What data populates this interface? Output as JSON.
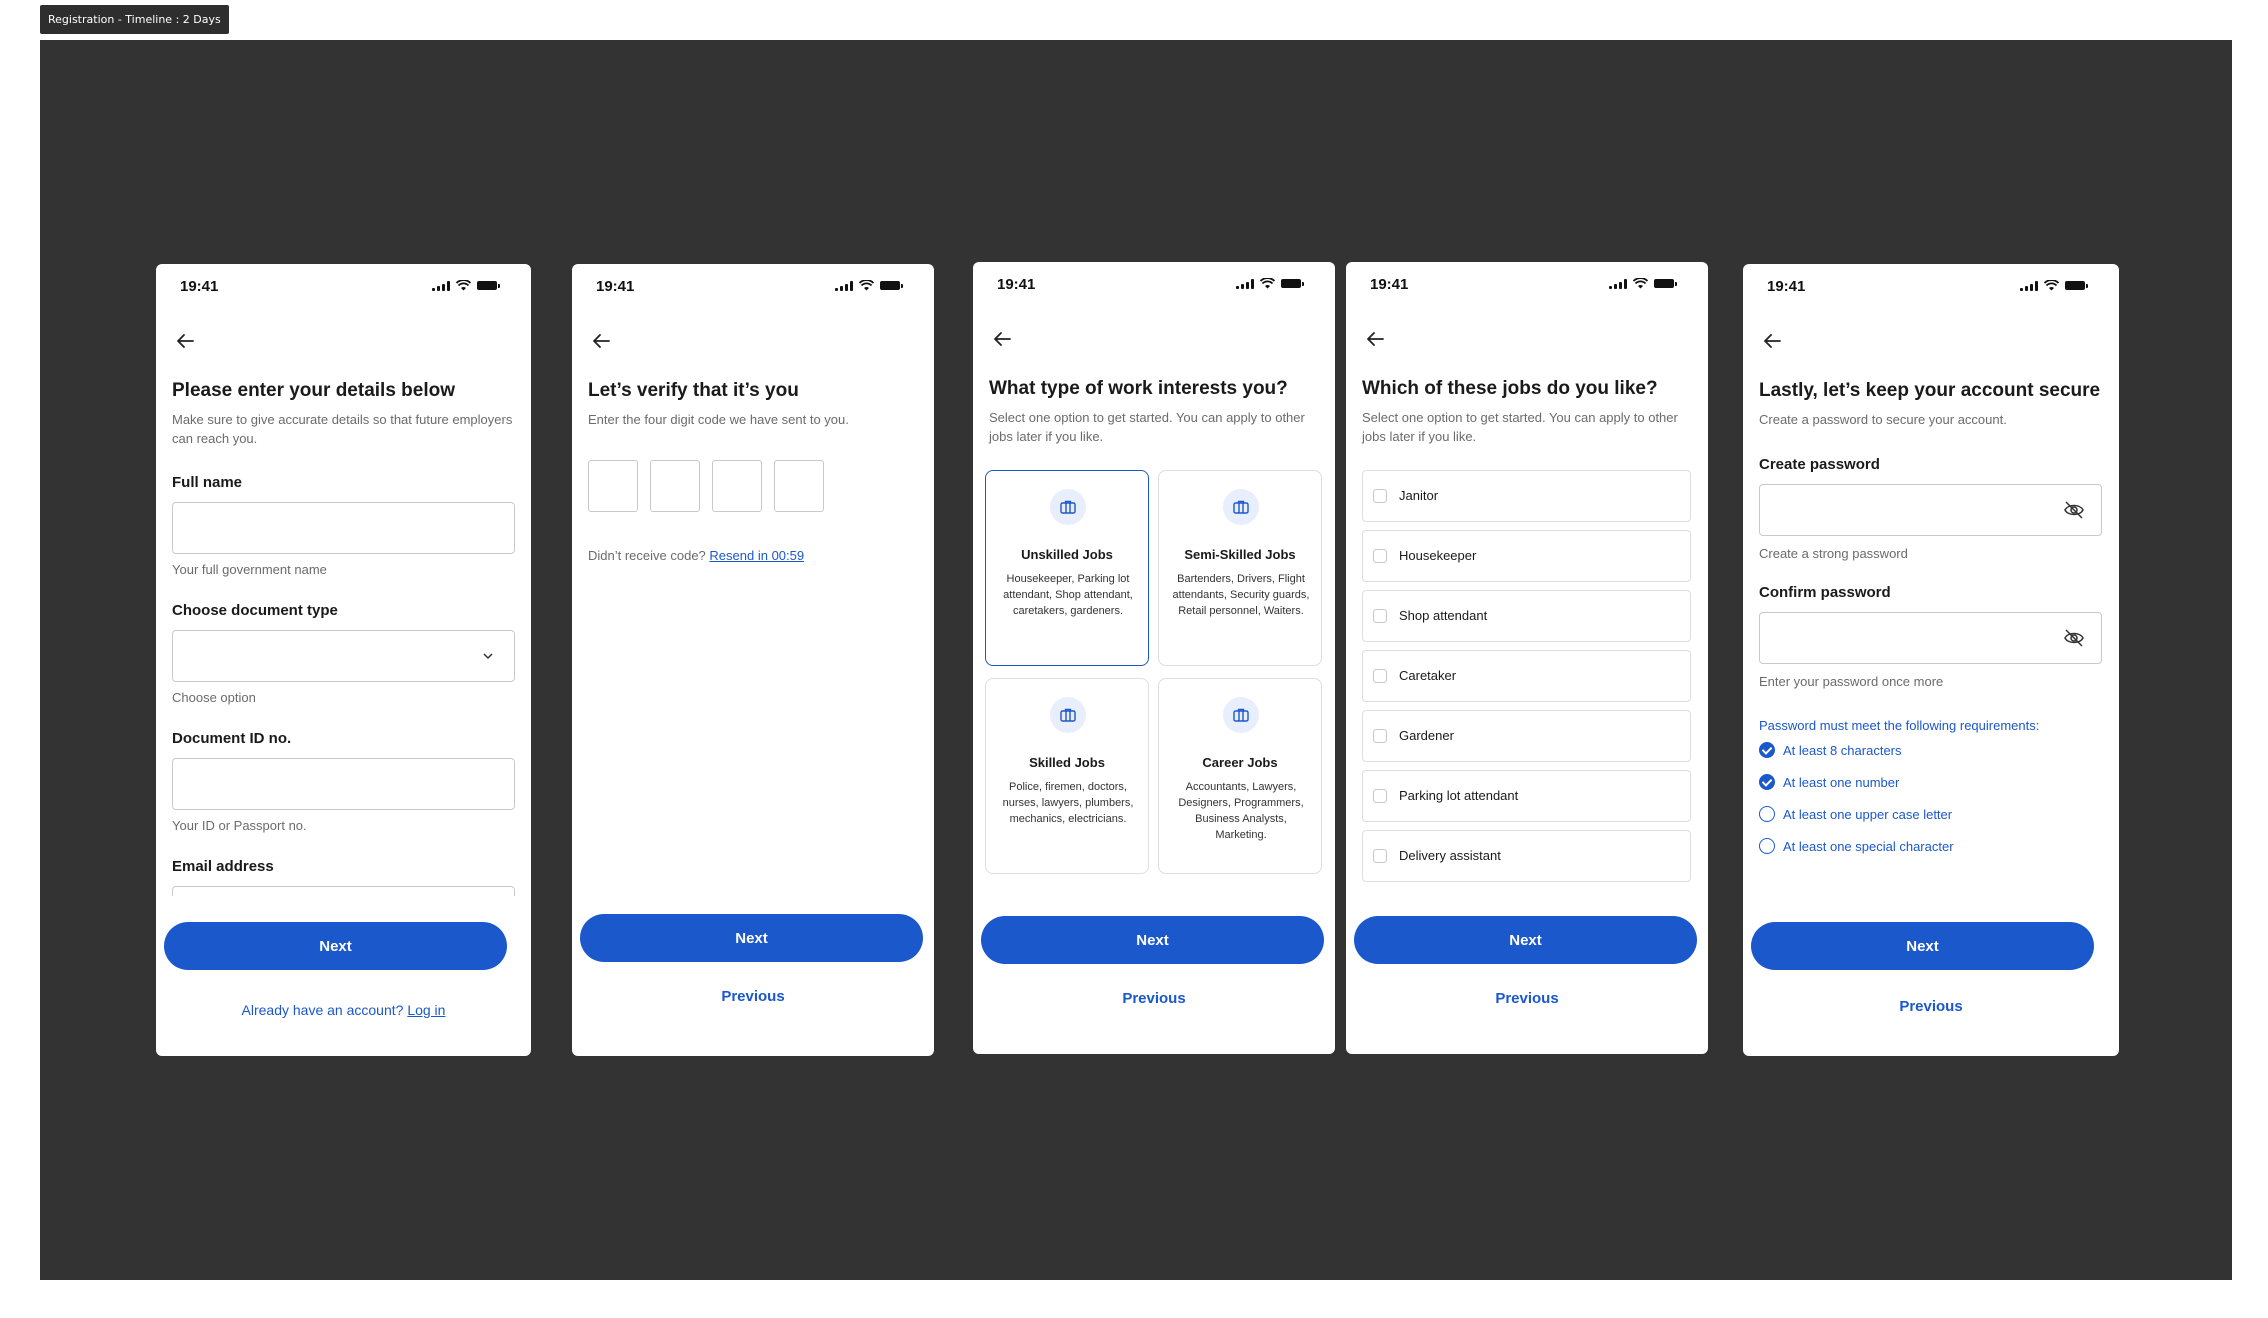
{
  "frame_label": "Registration - Timeline : 2 Days",
  "status_time": "19:41",
  "screens": {
    "details": {
      "title": "Please enter your details below",
      "subtitle": "Make sure to give accurate details so that future employers can reach you.",
      "full_name_label": "Full name",
      "full_name_hint": "Your full government name",
      "doc_type_label": "Choose document type",
      "doc_type_hint": "Choose option",
      "doc_id_label": "Document ID no.",
      "doc_id_hint": "Your ID or Passport no.",
      "email_label": "Email address",
      "next": "Next",
      "login_prompt": "Already have an account?",
      "login_link": "Log in"
    },
    "verify": {
      "title": "Let’s verify that it’s you",
      "subtitle": "Enter the four digit code we have sent to you.",
      "resend_prompt": "Didn’t receive code?",
      "resend_link": "Resend in 00:59",
      "next": "Next",
      "previous": "Previous"
    },
    "work_type": {
      "title": "What type of work interests you?",
      "subtitle": "Select one option to get started. You can apply to other jobs later if you like.",
      "cards": [
        {
          "title": "Unskilled Jobs",
          "desc": "Housekeeper, Parking lot attendant, Shop attendant, caretakers, gardeners.",
          "selected": true
        },
        {
          "title": "Semi-Skilled Jobs",
          "desc": "Bartenders, Drivers, Flight attendants, Security guards, Retail personnel, Waiters.",
          "selected": false
        },
        {
          "title": "Skilled Jobs",
          "desc": "Police, firemen, doctors, nurses, lawyers, plumbers, mechanics, electricians.",
          "selected": false
        },
        {
          "title": "Career Jobs",
          "desc": "Accountants, Lawyers, Designers, Programmers, Business Analysts, Marketing.",
          "selected": false
        }
      ],
      "next": "Next",
      "previous": "Previous"
    },
    "jobs": {
      "title": "Which of these jobs do you like?",
      "subtitle": "Select one option to get started. You can apply to other jobs later if you like.",
      "items": [
        "Janitor",
        "Housekeeper",
        "Shop attendant",
        "Caretaker",
        "Gardener",
        "Parking lot attendant",
        "Delivery assistant"
      ],
      "next": "Next",
      "previous": "Previous"
    },
    "password": {
      "title": "Lastly, let’s keep your account secure",
      "subtitle": "Create a password to secure your account.",
      "create_label": "Create password",
      "create_hint": "Create a strong password",
      "confirm_label": "Confirm password",
      "confirm_hint": "Enter your password once more",
      "req_title": "Password must meet the following requirements:",
      "requirements": [
        {
          "text": "At least 8 characters",
          "met": true
        },
        {
          "text": "At least one number",
          "met": true
        },
        {
          "text": "At least one upper case letter",
          "met": false
        },
        {
          "text": "At least one special character",
          "met": false
        }
      ],
      "next": "Next",
      "previous": "Previous"
    }
  },
  "colors": {
    "canvas": "#333333",
    "primary": "#1b58cc"
  }
}
